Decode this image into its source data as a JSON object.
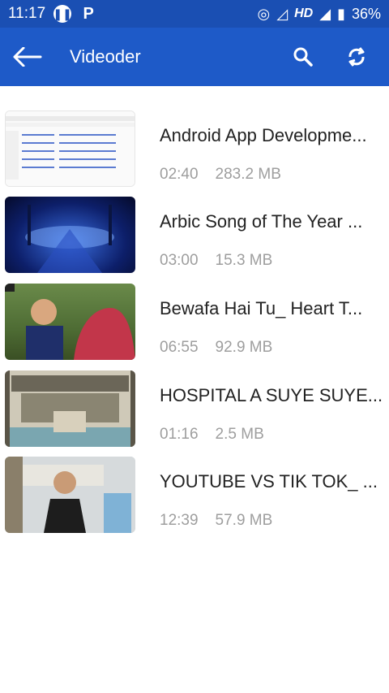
{
  "status": {
    "time": "11:17",
    "hd": "HD",
    "battery": "36%"
  },
  "appbar": {
    "title": "Videoder"
  },
  "items": [
    {
      "title": "Android App Developme...",
      "duration": "02:40",
      "size": "283.2 MB"
    },
    {
      "title": "Arbic Song of The Year ...",
      "duration": "03:00",
      "size": "15.3 MB"
    },
    {
      "title": "Bewafa Hai Tu_ Heart T...",
      "duration": "06:55",
      "size": "92.9 MB"
    },
    {
      "title": "HOSPITAL A SUYE SUYE...",
      "duration": "01:16",
      "size": "2.5 MB"
    },
    {
      "title": "YOUTUBE VS TIK TOK_ ...",
      "duration": "12:39",
      "size": "57.9 MB"
    }
  ]
}
